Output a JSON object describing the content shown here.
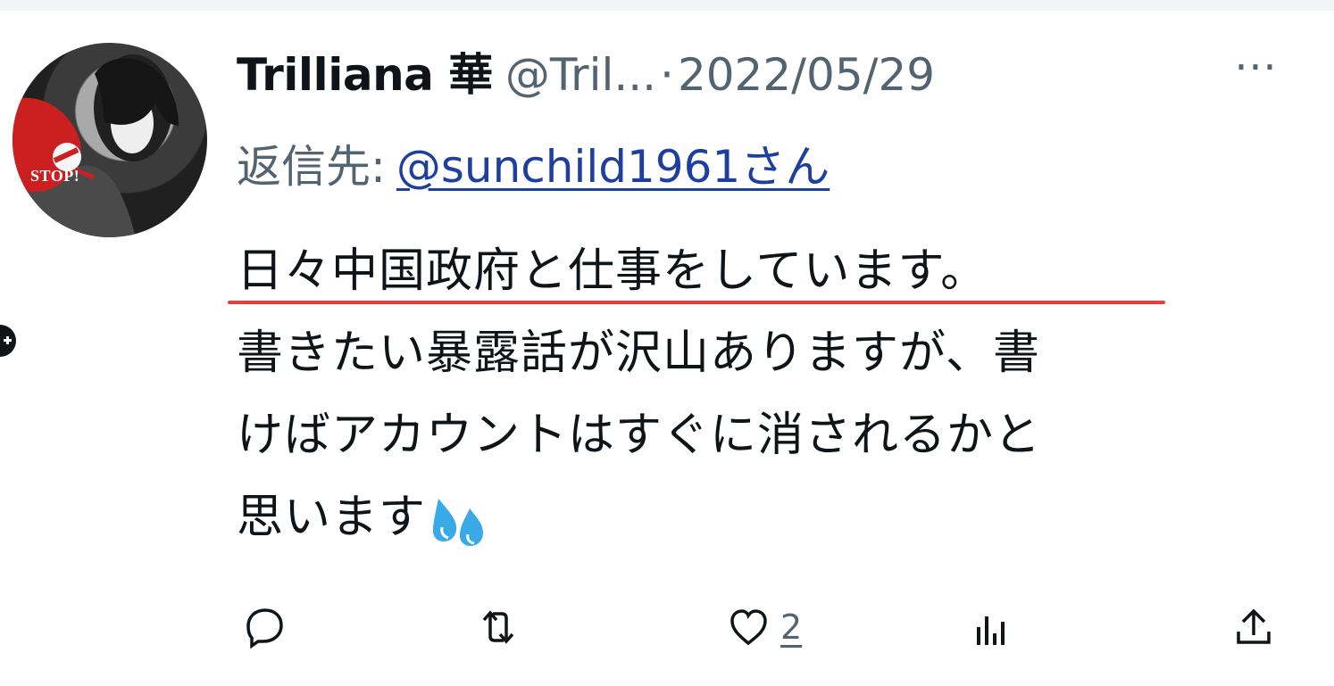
{
  "author": {
    "name": "Trilliana 華",
    "handle": "@Tril...",
    "separator": "·",
    "date": "2022/05/29",
    "avatar_badge": "STOP!"
  },
  "reply": {
    "label": "返信先:",
    "mention": "@sunchild1961さん"
  },
  "tweet": {
    "line1": "日々中国政府と仕事をしています。",
    "line2": "書きたい暴露話が沢山ありますが、書",
    "line3": "けばアカウントはすぐに消されるかと",
    "line4": "思います",
    "emoji": "sweat-droplets-emoji",
    "highlight_color": "#ef3b3b"
  },
  "menu": {
    "more_label": "⋯"
  },
  "actions": {
    "reply_icon": "reply-icon",
    "retweet_icon": "retweet-icon",
    "like_icon": "heart-icon",
    "like_count": "2",
    "views_icon": "views-icon",
    "share_icon": "share-icon"
  },
  "colors": {
    "text": "#0f1419",
    "secondary": "#536471",
    "mention": "#1d3f9f"
  }
}
